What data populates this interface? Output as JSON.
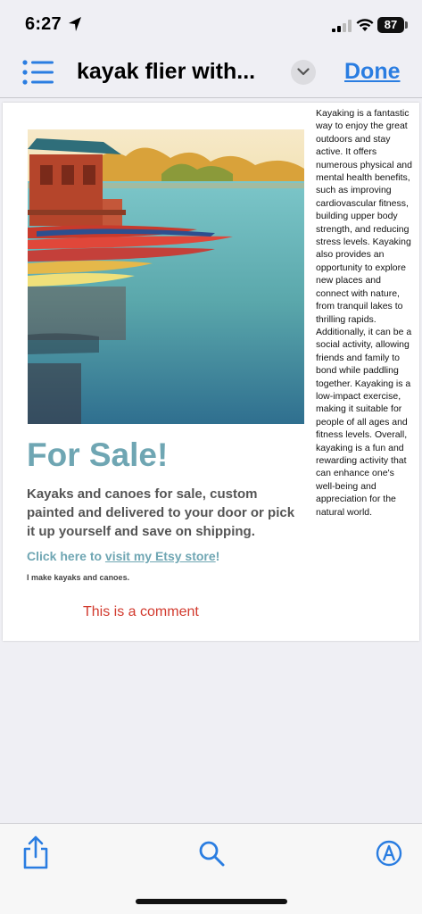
{
  "status_bar": {
    "time": "6:27",
    "battery": "87"
  },
  "nav": {
    "title": "kayak flier with...",
    "done_label": "Done"
  },
  "document": {
    "photo_alt": "",
    "headline": "For Sale!",
    "description": "Kayaks and canoes for sale, custom painted and delivered to your door or pick it up yourself and save on shipping.",
    "etsy_prefix": "Click here to ",
    "etsy_link": "visit my Etsy store",
    "etsy_suffix": "!",
    "note": "I make kayaks and canoes.",
    "comment": "This is a comment",
    "side_text": "Kayaking is a fantastic way to enjoy the great outdoors and stay active. It offers numerous physical and mental health benefits, such as improving cardiovascular fitness, building upper body strength, and reducing stress levels. Kayaking also provides an opportunity to explore new places and connect with nature, from tranquil lakes to thrilling rapids. Additionally, it can be a social activity, allowing friends and family to bond while paddling together. Kayaking is a low-impact exercise, making it suitable for people of all ages and fitness levels. Overall, kayaking is a fun and rewarding activity that can enhance one's well-being and appreciation for the natural world."
  },
  "toolbar": {
    "icons": [
      "share-icon",
      "search-icon",
      "markup-icon"
    ]
  },
  "colors": {
    "accent": "#2a7de1",
    "headline": "#6fa6b3",
    "comment": "#d23a2e"
  }
}
